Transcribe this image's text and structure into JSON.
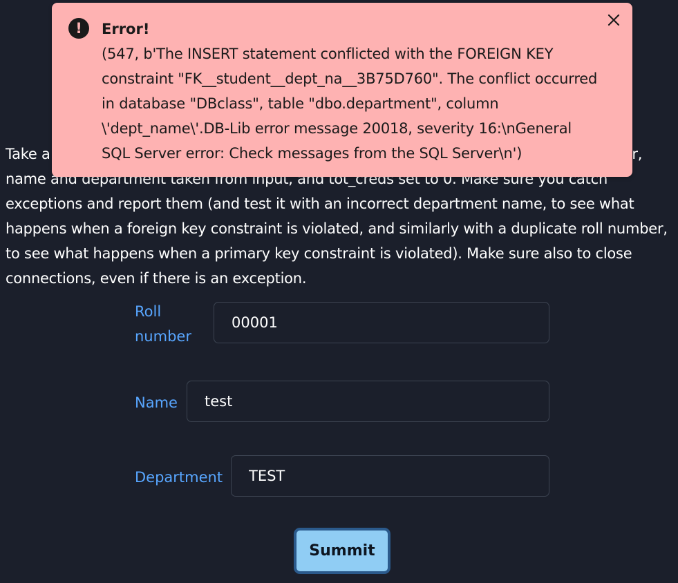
{
  "description": "Take a Python program that inserts a tuple into the student relation, with the roll number, name and department taken from input, and tot_creds set to 0. Make sure you catch exceptions and report them (and test it with an incorrect department name, to see what happens when a foreign key constraint is violated, and similarly with a duplicate roll number, to see what happens when a primary key constraint is violated). Make sure also to close connections, even if there is an exception.",
  "form": {
    "roll": {
      "label": "Roll number",
      "value": "00001"
    },
    "name": {
      "label": "Name",
      "value": "test"
    },
    "department": {
      "label": "Department",
      "value": "TEST"
    },
    "submit_label": "Summit"
  },
  "alert": {
    "title": "Error!",
    "message": "(547, b'The INSERT statement conflicted with the FOREIGN KEY constraint \"FK__student__dept_na__3B75D760\". The conflict occurred in database \"DBclass\", table \"dbo.department\", column \\'dept_name\\'.DB-Lib error message 20018, severity 16:\\nGeneral SQL Server error: Check messages from the SQL Server\\n')",
    "icon": "exclamation-circle-icon",
    "close_icon": "close-icon",
    "background": "#feb2b2"
  },
  "colors": {
    "page_background": "#1b1f2b",
    "label": "#58a6ff",
    "button": "#90cdf4",
    "button_border": "#2b5a8c"
  }
}
